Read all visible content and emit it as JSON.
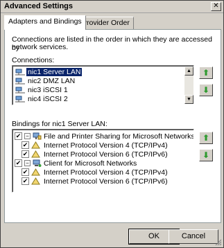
{
  "window": {
    "title": "Advanced Settings",
    "close_glyph": "✕"
  },
  "tabs": [
    {
      "label": "Adapters and Bindings",
      "active": true
    },
    {
      "label": "Provider Order",
      "active": false
    }
  ],
  "description": {
    "line1": "Connections are listed in the order in which they are accessed by",
    "line2": "network services."
  },
  "connections": {
    "label": "Connections:",
    "items": [
      {
        "label": "nic1 Server LAN",
        "selected": true
      },
      {
        "label": "nic2 DMZ LAN",
        "selected": false
      },
      {
        "label": "nic3 iSCSI 1",
        "selected": false
      },
      {
        "label": "nic4 iSCSI 2",
        "selected": false
      }
    ]
  },
  "bindings": {
    "label": "Bindings for nic1 Server LAN:",
    "items": [
      {
        "label": "File and Printer Sharing for Microsoft Networks",
        "checked": true,
        "level": 0,
        "expander": "−",
        "icon": "network-share-icon"
      },
      {
        "label": "Internet Protocol Version 4 (TCP/IPv4)",
        "checked": true,
        "level": 1,
        "icon": "protocol-icon"
      },
      {
        "label": "Internet Protocol Version 6 (TCP/IPv6)",
        "checked": true,
        "level": 1,
        "icon": "protocol-icon"
      },
      {
        "label": "Client for Microsoft Networks",
        "checked": true,
        "level": 0,
        "expander": "−",
        "icon": "network-client-icon"
      },
      {
        "label": "Internet Protocol Version 4 (TCP/IPv4)",
        "checked": true,
        "level": 1,
        "icon": "protocol-icon"
      },
      {
        "label": "Internet Protocol Version 6 (TCP/IPv6)",
        "checked": true,
        "level": 1,
        "icon": "protocol-icon"
      }
    ]
  },
  "buttons": {
    "ok": "OK",
    "cancel": "Cancel"
  },
  "glyphs": {
    "check": "✔",
    "arrow_up": "⬆",
    "arrow_down": "⬇",
    "scroll_up": "▲",
    "scroll_down": "▼"
  },
  "colors": {
    "selection": "#0a246a",
    "move_arrow": "#2e9a2e"
  }
}
